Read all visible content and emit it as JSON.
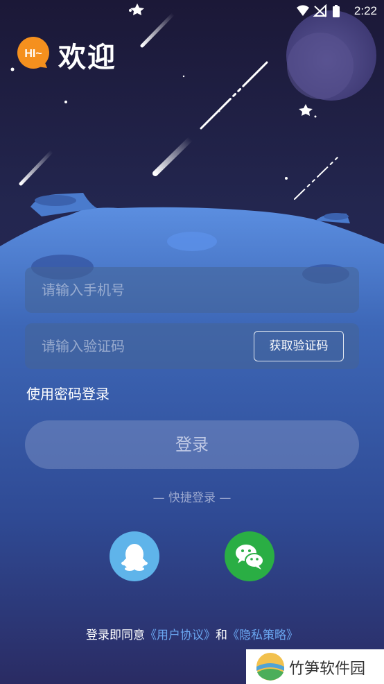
{
  "status_bar": {
    "time": "2:22"
  },
  "header": {
    "badge_text": "HI~",
    "title": "欢迎"
  },
  "form": {
    "phone_placeholder": "请输入手机号",
    "code_placeholder": "请输入验证码",
    "get_code_label": "获取验证码",
    "password_login_label": "使用密码登录",
    "login_label": "登录"
  },
  "quick_login": {
    "title": "— 快捷登录 —",
    "options": [
      {
        "name": "qq",
        "icon": "qq-penguin-icon",
        "color": "#5fb4ea"
      },
      {
        "name": "wechat",
        "icon": "wechat-icon",
        "color": "#2aae44"
      }
    ]
  },
  "agreement": {
    "prefix": "登录即同意",
    "user_agreement": "《用户协议》",
    "and": "和",
    "privacy_policy": "《隐私策略》"
  },
  "watermark": {
    "text": "竹笋软件园"
  },
  "colors": {
    "bg_top": "#1c1a3b",
    "planet": "#3c64b4",
    "link": "#6aa6f0"
  }
}
